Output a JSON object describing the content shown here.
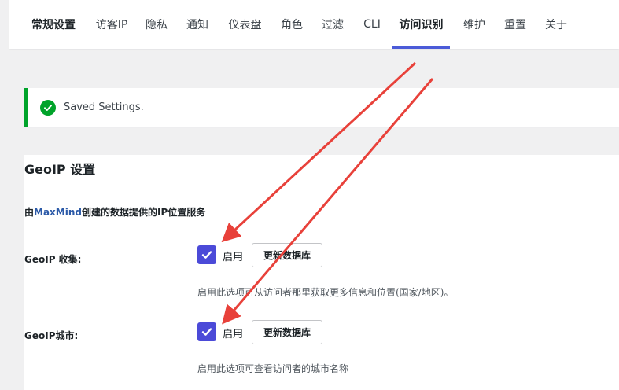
{
  "tabs": [
    {
      "label": "常规设置"
    },
    {
      "label": "访客IP"
    },
    {
      "label": "隐私"
    },
    {
      "label": "通知"
    },
    {
      "label": "仪表盘"
    },
    {
      "label": "角色"
    },
    {
      "label": "过滤"
    },
    {
      "label": "CLI"
    },
    {
      "label": "访问识别",
      "active": true
    },
    {
      "label": "维护"
    },
    {
      "label": "重置"
    },
    {
      "label": "关于"
    }
  ],
  "notice": {
    "text": "Saved Settings."
  },
  "section": {
    "title": "GeoIP 设置",
    "desc_prefix": "由",
    "desc_link": "MaxMind",
    "desc_suffix": "创建的数据提供的IP位置服务"
  },
  "rows": [
    {
      "label": "GeoIP 收集:",
      "checked": true,
      "enable_label": "启用",
      "button_label": "更新数据库",
      "help": "启用此选项可从访问者那里获取更多信息和位置(国家/地区)。"
    },
    {
      "label": "GeoIP城市:",
      "checked": true,
      "enable_label": "启用",
      "button_label": "更新数据库",
      "help": "启用此选项可查看访问者的城市名称"
    }
  ],
  "colors": {
    "accent": "#4b5bd8",
    "checkbox": "#4b4ad8",
    "success": "#00a32a",
    "link": "#2c5aa8",
    "arrow": "#e8413a"
  }
}
